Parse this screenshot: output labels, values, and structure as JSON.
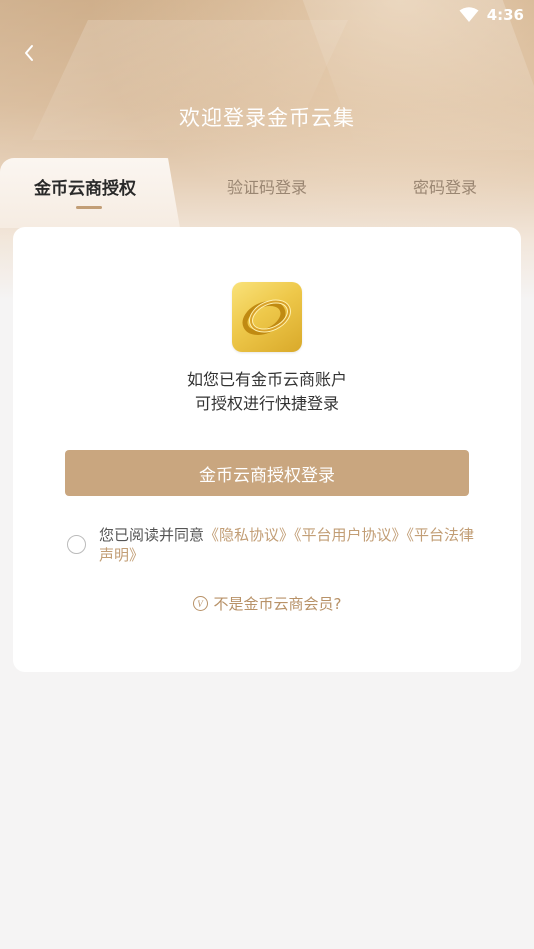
{
  "status_bar": {
    "time": "4:36"
  },
  "header": {
    "title": "欢迎登录金币云集"
  },
  "tabs": [
    {
      "label": "金币云商授权",
      "active": true
    },
    {
      "label": "验证码登录",
      "active": false
    },
    {
      "label": "密码登录",
      "active": false
    }
  ],
  "card": {
    "description_line1": "如您已有金币云商账户",
    "description_line2": "可授权进行快捷登录",
    "auth_button": "金币云商授权登录",
    "agreement": {
      "prefix": "您已阅读并同意",
      "privacy": "《隐私协议》",
      "user_agreement": "《平台用户协议》",
      "legal": "《平台法律声明》"
    },
    "not_member": "不是金币云商会员?"
  },
  "colors": {
    "accent": "#c9a67f",
    "link": "#c29e76",
    "logo_gold": "#eec84a"
  }
}
